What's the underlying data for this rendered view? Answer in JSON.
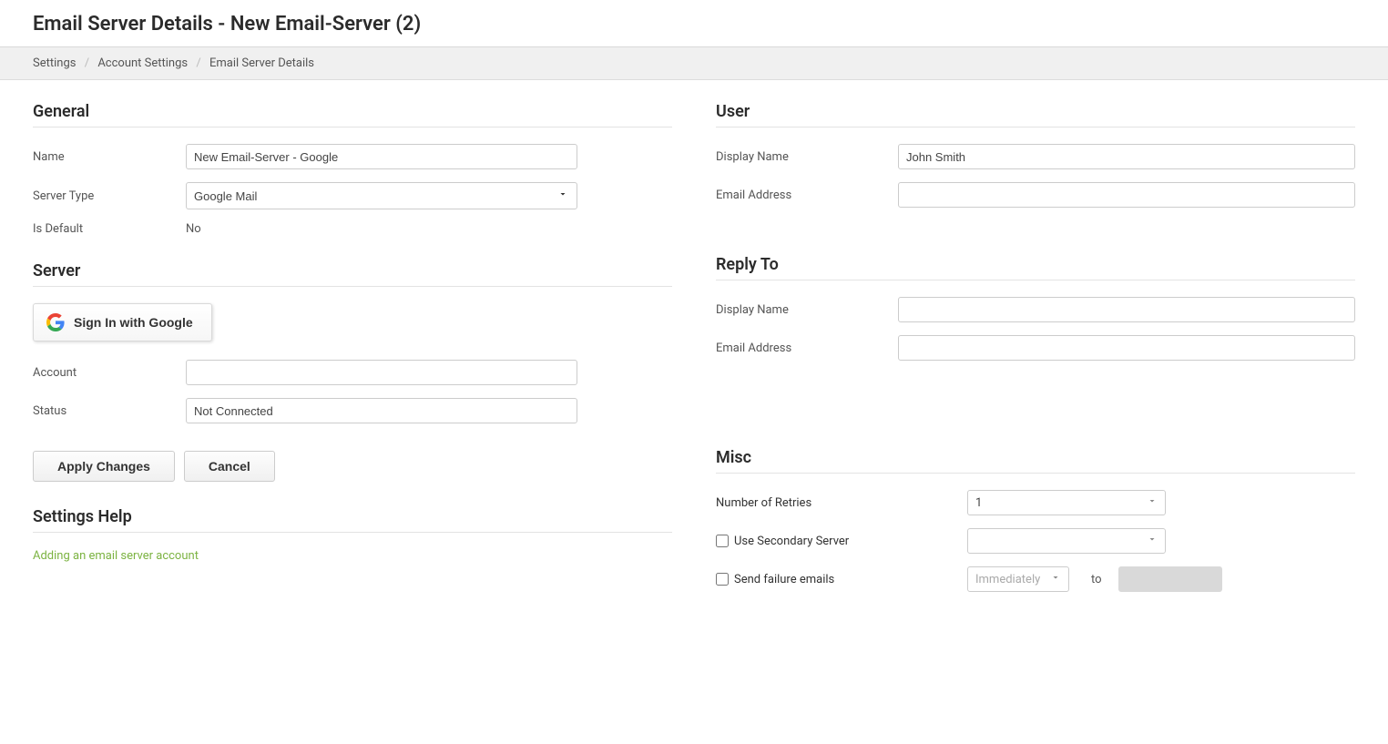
{
  "header": {
    "title": "Email Server Details - New Email-Server (2)"
  },
  "breadcrumb": {
    "items": [
      "Settings",
      "Account Settings",
      "Email Server Details"
    ]
  },
  "general": {
    "title": "General",
    "name_label": "Name",
    "name_value": "New Email-Server - Google",
    "server_type_label": "Server Type",
    "server_type_value": "Google Mail",
    "is_default_label": "Is Default",
    "is_default_value": "No"
  },
  "server": {
    "title": "Server",
    "google_button_label": "Sign In with Google",
    "account_label": "Account",
    "account_value": "",
    "status_label": "Status",
    "status_value": "Not Connected"
  },
  "user": {
    "title": "User",
    "display_name_label": "Display Name",
    "display_name_value": "John Smith",
    "email_label": "Email Address",
    "email_value": ""
  },
  "reply_to": {
    "title": "Reply To",
    "display_name_label": "Display Name",
    "display_name_value": "",
    "email_label": "Email Address",
    "email_value": ""
  },
  "misc": {
    "title": "Misc",
    "retries_label": "Number of Retries",
    "retries_value": "1",
    "secondary_label": "Use Secondary Server",
    "secondary_value": "",
    "failure_label": "Send failure emails",
    "failure_timing_value": "Immediately",
    "to_label": "to"
  },
  "actions": {
    "apply": "Apply Changes",
    "cancel": "Cancel"
  },
  "help": {
    "title": "Settings Help",
    "link_label": "Adding an email server account"
  }
}
